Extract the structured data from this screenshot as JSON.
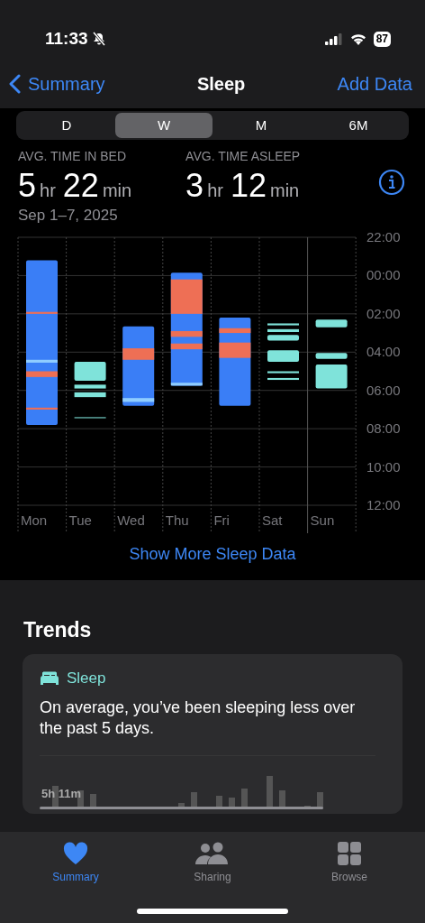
{
  "status_bar": {
    "time": "11:33",
    "battery": "87"
  },
  "nav": {
    "back": "Summary",
    "title": "Sleep",
    "action": "Add Data"
  },
  "segments": [
    {
      "label": "D",
      "selected": false
    },
    {
      "label": "W",
      "selected": true
    },
    {
      "label": "M",
      "selected": false
    },
    {
      "label": "6M",
      "selected": false
    }
  ],
  "stats": [
    {
      "label": "AVG. TIME IN BED",
      "parts": [
        {
          "value": "5",
          "unit": "hr"
        },
        {
          "value": "22",
          "unit": "min"
        }
      ]
    },
    {
      "label": "AVG. TIME ASLEEP",
      "parts": [
        {
          "value": "3",
          "unit": "hr"
        },
        {
          "value": "12",
          "unit": "min"
        }
      ]
    }
  ],
  "date_range": "Sep 1–7, 2025",
  "sleep_chart": {
    "days": [
      "Mon",
      "Tue",
      "Wed",
      "Thu",
      "Fri",
      "Sat",
      "Sun"
    ],
    "time_labels": [
      "22:00",
      "00:00",
      "02:00",
      "04:00",
      "06:00",
      "08:00",
      "10:00",
      "12:00"
    ]
  },
  "show_more": "Show More Sleep Data",
  "trends": {
    "title": "Trends",
    "card": {
      "category": "Sleep",
      "message": "On average, you’ve been sleeping less over the past 5 days.",
      "chart_label": "5h 11m"
    }
  },
  "tab_bar": [
    {
      "label": "Summary",
      "selected": true
    },
    {
      "label": "Sharing",
      "selected": false
    },
    {
      "label": "Browse",
      "selected": false
    }
  ]
}
